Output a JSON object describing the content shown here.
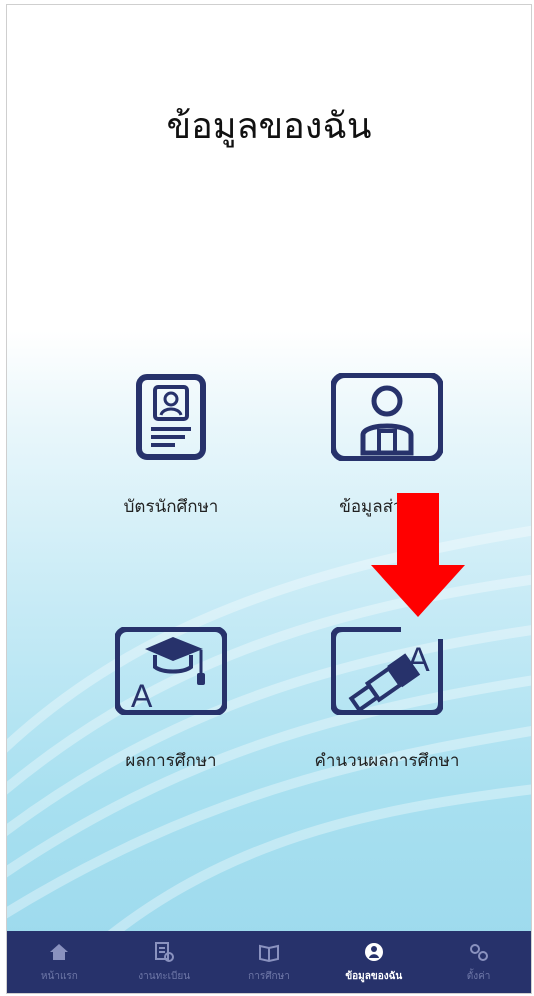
{
  "page": {
    "title": "ข้อมูลของฉัน"
  },
  "menu": [
    {
      "label": "บัตรนักศึกษา",
      "icon": "id-card-icon"
    },
    {
      "label": "ข้อมูลส่วนตัว",
      "icon": "person-icon"
    },
    {
      "label": "ผลการศึกษา",
      "icon": "grade-cap-icon"
    },
    {
      "label": "คำนวนผลการศึกษา",
      "icon": "telescope-grade-icon"
    }
  ],
  "nav": [
    {
      "label": "หน้าแรก",
      "icon": "home-icon"
    },
    {
      "label": "งานทะเบียน",
      "icon": "registration-icon"
    },
    {
      "label": "การศึกษา",
      "icon": "book-icon"
    },
    {
      "label": "ข้อมูลของฉัน",
      "icon": "profile-icon",
      "active": true
    },
    {
      "label": "ตั้งค่า",
      "icon": "settings-icon"
    }
  ],
  "colors": {
    "icon": "#27326b",
    "nav_bg": "#27326b",
    "arrow": "#ff0000"
  }
}
